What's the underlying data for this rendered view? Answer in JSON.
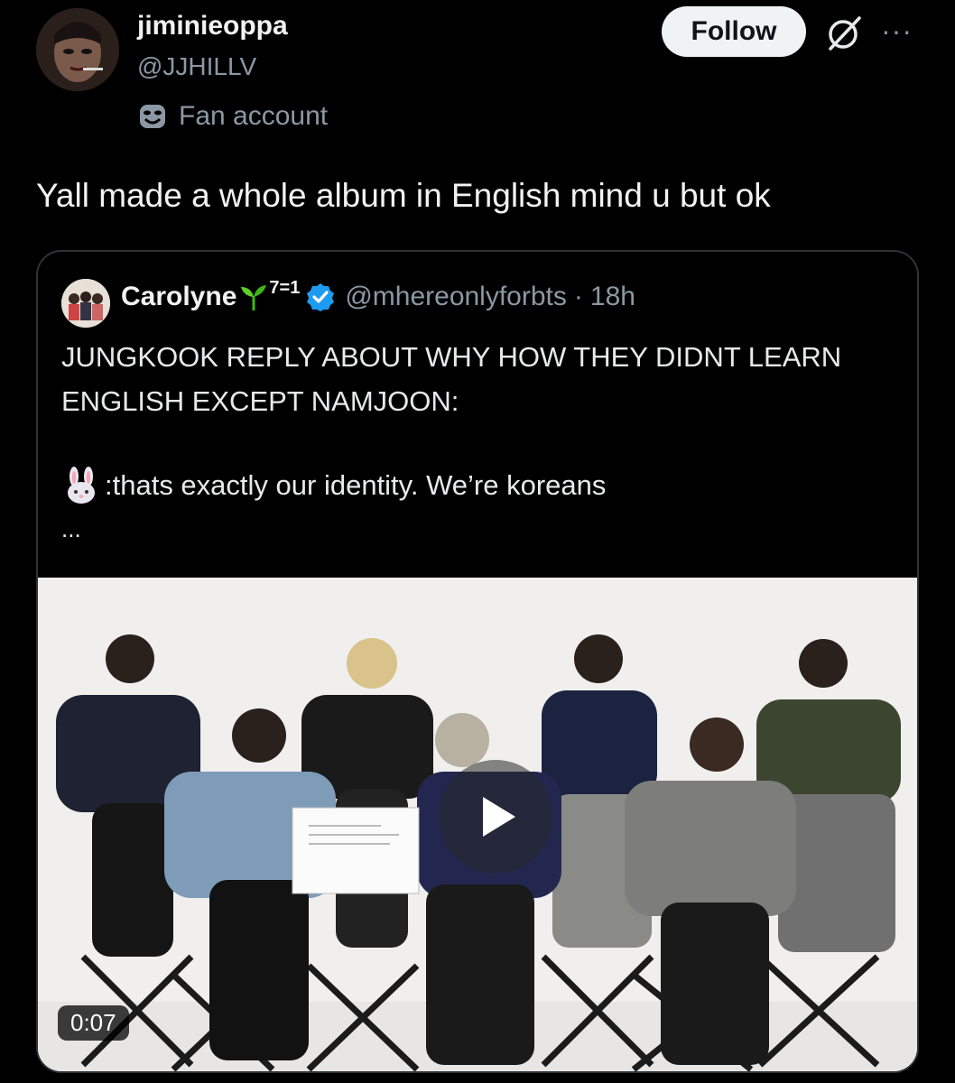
{
  "author": {
    "display_name": "jiminieoppa",
    "handle": "@JJHILLV",
    "label": "Fan account",
    "avatar_icon": "profile-avatar"
  },
  "actions": {
    "follow_label": "Follow",
    "grok_icon": "grok-icon",
    "more_icon": "more-options-icon",
    "more_glyph": "···"
  },
  "tweet": {
    "text": "Yall made a whole album in English mind u but ok"
  },
  "quote": {
    "display_name": "Carolyne",
    "name_superscript": "7=1",
    "handle": "@mhereonlyforbts",
    "separator": "·",
    "time": "18h",
    "text_lines": [
      "JUNGKOOK REPLY ABOUT WHY HOW THEY DIDNT LEARN",
      "ENGLISH EXCEPT NAMJOON:"
    ],
    "reply_text": ":thats exactly our identity. We’re koreans",
    "ellipsis": "...",
    "verified_color": "#1d9bf0",
    "sprout_color": "#3fb618"
  },
  "video": {
    "duration": "0:07",
    "play_icon": "play-icon"
  }
}
